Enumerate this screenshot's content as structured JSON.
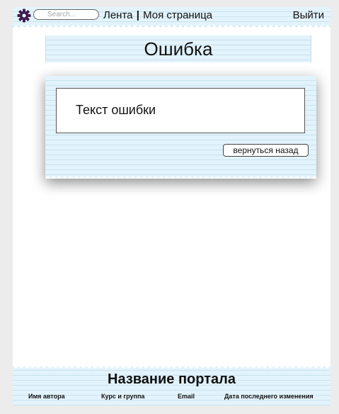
{
  "header": {
    "search_placeholder": "Search...",
    "nav_feed": "Лента",
    "nav_separator": "|",
    "nav_my_page": "Моя страница",
    "logout": "Выйти",
    "settings_icon": "gear-icon",
    "accent_color": "#3d1a4f"
  },
  "page": {
    "title": "Ошибка"
  },
  "error": {
    "message": "Текст ошибки",
    "back_button": "вернуться назад"
  },
  "footer": {
    "portal_name": "Название портала",
    "author": "Имя автора",
    "course": "Курс и группа",
    "email": "Email",
    "last_modified": "Дата последнего изменения"
  },
  "colors": {
    "paper": "#e3f3fb",
    "paper_lines": "#c9e2ee",
    "background": "#ececec"
  }
}
